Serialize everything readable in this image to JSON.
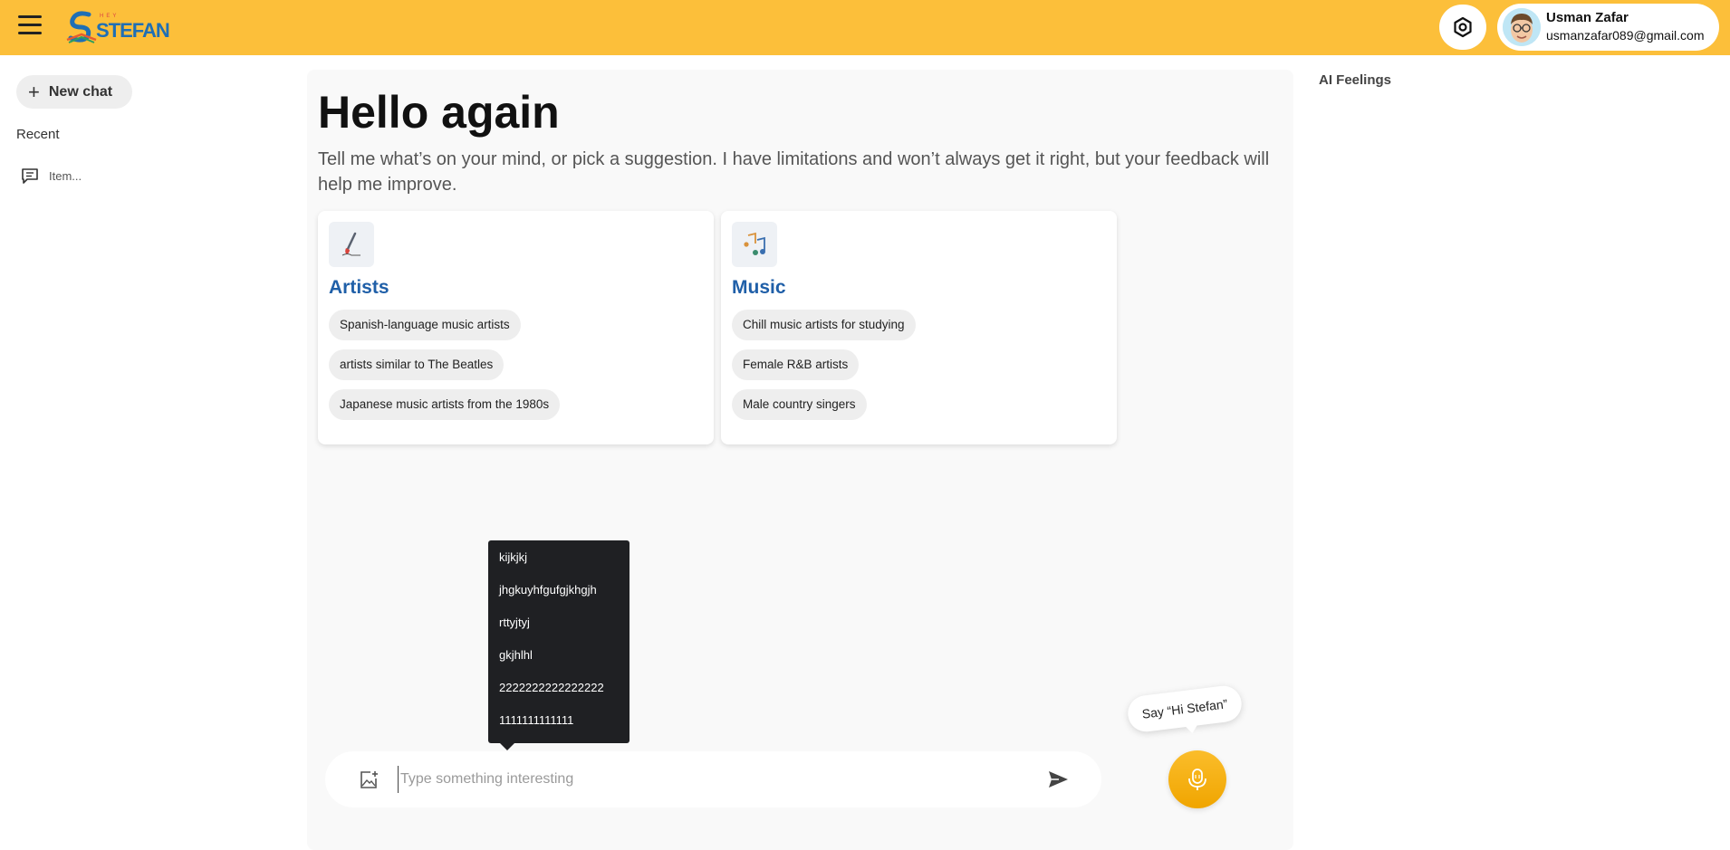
{
  "header": {
    "logo_text": "STEFAN",
    "logo_small": "HEY",
    "user": {
      "name": "Usman Zafar",
      "email": "usmanzafar089@gmail.com"
    },
    "colors": {
      "bar": "#fcbf3a"
    },
    "icons": {
      "menu": "hamburger-icon",
      "settings": "settings-icon",
      "avatar": "memoji-avatar"
    }
  },
  "sidebar": {
    "new_chat_label": "New chat",
    "recent_label": "Recent",
    "recent_items": [
      {
        "label": "Item...",
        "icon": "chat-icon"
      }
    ]
  },
  "main": {
    "greeting": "Hello again",
    "intro": "Tell me what’s on your mind, or pick a suggestion. I have limitations and won’t always get it right, but your feedback will help me improve.",
    "cards": [
      {
        "title": "Artists",
        "icon": "paintbrush-icon",
        "suggestions": [
          "Spanish-language music artists",
          "artists similar to The Beatles",
          "Japanese music artists from the 1980s"
        ]
      },
      {
        "title": "Music",
        "icon": "music-notes-icon",
        "suggestions": [
          "Chill music artists for studying",
          "Female R&B artists",
          "Male country singers"
        ]
      }
    ],
    "popup_items": [
      "kijkjkj",
      "jhgkuyhfgufgjkhgjh",
      "rttyjtyj",
      "gkjhlhl",
      "2222222222222222",
      "1111111111111"
    ],
    "input": {
      "placeholder": "Type something interesting",
      "value": ""
    },
    "say_bubble": "Say “Hi Stefan”",
    "accent": "#1f5fa8"
  },
  "right_panel": {
    "title": "AI Feelings"
  }
}
